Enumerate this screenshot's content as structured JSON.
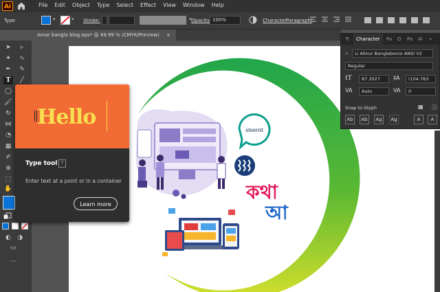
{
  "menubar": {
    "app_logo": "Ai",
    "menus": [
      "File",
      "Edit",
      "Object",
      "Type",
      "Select",
      "Effect",
      "View",
      "Window",
      "Help"
    ]
  },
  "control_bar": {
    "tool_name": "Type",
    "stroke_label": "Stroke:",
    "opacity_label": "Opacity:",
    "opacity_value": "100%",
    "character_link": "Character",
    "paragraph_link": "Paragraph:"
  },
  "document_tab": {
    "title": "Amar bangla blog.eps* @ 49.99 % (CMYK/Preview)",
    "close": "×"
  },
  "tooltip": {
    "preview_text": "Hello",
    "title": "Type tool",
    "shortcut": "T",
    "description": "Enter text at a point or in a container",
    "button": "Learn more"
  },
  "character_panel": {
    "tabs": [
      "Tr",
      "Character",
      "Pa",
      "O",
      "Pa",
      "Al"
    ],
    "more": "»",
    "font_family": "Li Alinur Banglaborno ANSI V2",
    "font_style": "Regular",
    "font_size": "87.3027",
    "leading": "(104.763",
    "kerning": "Auto",
    "tracking": "0",
    "snap_label": "Snap to Glyph",
    "glyph_buttons": [
      "Ab",
      "Ab",
      "Ag",
      "Ag",
      "A",
      "A"
    ]
  },
  "artwork": {
    "badge_text": "steemit",
    "bangla_line1": "কথা",
    "bangla_line2": "আ"
  },
  "colors": {
    "accent_orange": "#f26b34",
    "ring_green": "#21a64b",
    "ring_yellow": "#d3df2b",
    "fill_blue": "#0a73d9",
    "steemit_teal": "#0a9e8c"
  }
}
